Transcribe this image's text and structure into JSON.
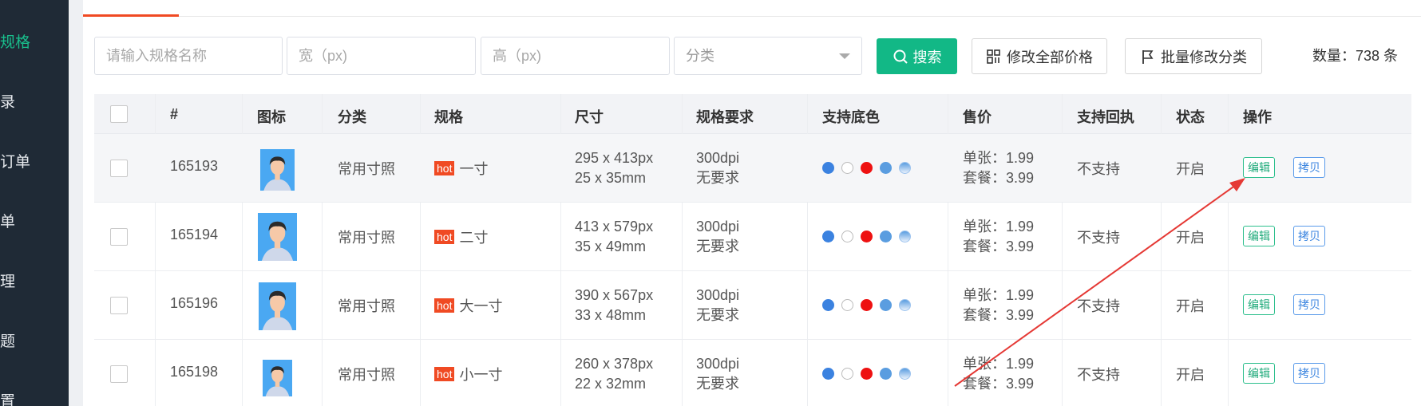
{
  "sidebar": {
    "items": [
      {
        "label": "规格",
        "active": true
      },
      {
        "label": "录",
        "active": false
      },
      {
        "label": "订单",
        "active": false
      },
      {
        "label": "单",
        "active": false
      },
      {
        "label": "理",
        "active": false
      },
      {
        "label": "题",
        "active": false
      },
      {
        "label": "置",
        "active": false
      }
    ]
  },
  "filters": {
    "name_placeholder": "请输入规格名称",
    "width_placeholder": "宽（px)",
    "height_placeholder": "高（px)",
    "category_placeholder": "分类"
  },
  "buttons": {
    "search": "搜索",
    "edit_all_prices": "修改全部价格",
    "batch_category": "批量修改分类"
  },
  "count_text": "数量：738 条",
  "table": {
    "headers": [
      "#",
      "图标",
      "分类",
      "规格",
      "尺寸",
      "规格要求",
      "支持底色",
      "售价",
      "支持回执",
      "状态",
      "操作"
    ],
    "rows": [
      {
        "id": "165193",
        "category": "常用寸照",
        "hot": "hot",
        "spec": "一寸",
        "size_px": "295 x 413px",
        "size_mm": "25 x 35mm",
        "dpi": "300dpi",
        "req": "无要求",
        "price_single": "单张：1.99",
        "price_set": "套餐：3.99",
        "receipt": "不支持",
        "status": "开启",
        "edit": "编辑",
        "copy": "拷贝"
      },
      {
        "id": "165194",
        "category": "常用寸照",
        "hot": "hot",
        "spec": "二寸",
        "size_px": "413 x 579px",
        "size_mm": "35 x 49mm",
        "dpi": "300dpi",
        "req": "无要求",
        "price_single": "单张：1.99",
        "price_set": "套餐：3.99",
        "receipt": "不支持",
        "status": "开启",
        "edit": "编辑",
        "copy": "拷贝"
      },
      {
        "id": "165196",
        "category": "常用寸照",
        "hot": "hot",
        "spec": "大一寸",
        "size_px": "390 x 567px",
        "size_mm": "33 x 48mm",
        "dpi": "300dpi",
        "req": "无要求",
        "price_single": "单张：1.99",
        "price_set": "套餐：3.99",
        "receipt": "不支持",
        "status": "开启",
        "edit": "编辑",
        "copy": "拷贝"
      },
      {
        "id": "165198",
        "category": "常用寸照",
        "hot": "hot",
        "spec": "小一寸",
        "size_px": "260 x 378px",
        "size_mm": "22 x 32mm",
        "dpi": "300dpi",
        "req": "无要求",
        "price_single": "单张：1.99",
        "price_set": "套餐：3.99",
        "receipt": "不支持",
        "status": "开启",
        "edit": "编辑",
        "copy": "拷贝"
      }
    ]
  },
  "colors": {
    "accent": "#12b886",
    "hot": "#f04a23",
    "sidebar_bg": "#1f2a36",
    "bg_dots": [
      "#3b82e0",
      "#ffffff",
      "#ee1111",
      "#5a9de0",
      "#9cc3ee"
    ]
  }
}
